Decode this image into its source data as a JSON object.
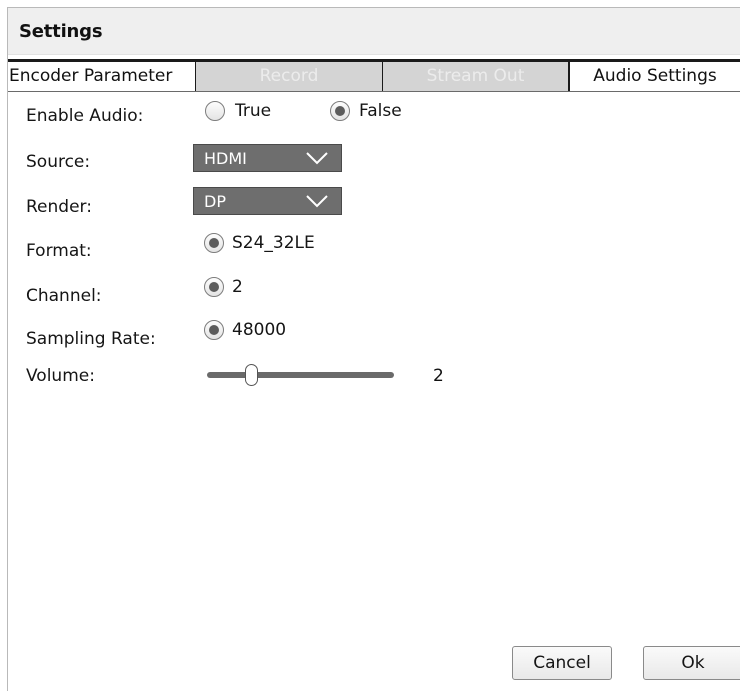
{
  "window": {
    "title": "Settings"
  },
  "tabs": [
    {
      "label": "Encoder Parameter",
      "state": "normal"
    },
    {
      "label": "Record",
      "state": "disabled"
    },
    {
      "label": "Stream Out",
      "state": "disabled"
    },
    {
      "label": "Audio Settings",
      "state": "active"
    }
  ],
  "form": {
    "enable_audio": {
      "label": "Enable Audio:",
      "options": [
        "True",
        "False"
      ],
      "selected": "False"
    },
    "source": {
      "label": "Source:",
      "value": "HDMI"
    },
    "render": {
      "label": "Render:",
      "value": "DP"
    },
    "format": {
      "label": "Format:",
      "value": "S24_32LE"
    },
    "channel": {
      "label": "Channel:",
      "value": "2"
    },
    "sampling_rate": {
      "label": "Sampling Rate:",
      "value": "48000"
    },
    "volume": {
      "label": "Volume:",
      "value": "2"
    }
  },
  "buttons": {
    "cancel": "Cancel",
    "ok": "Ok"
  },
  "colors": {
    "combo_background": "#6e6e6e",
    "disabled_tab": "#d4d4d4",
    "titlebar": "#efefef"
  }
}
